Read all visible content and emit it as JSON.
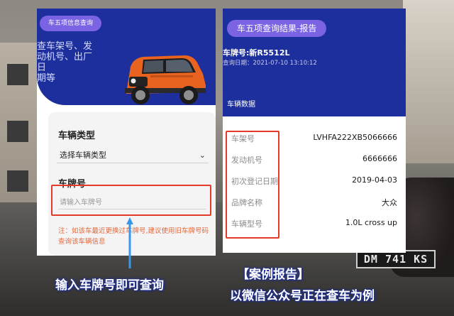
{
  "left_panel": {
    "pill": "车五项信息查询",
    "hero_lines": [
      "查车架号、发",
      "动机号、出厂日",
      "期等"
    ],
    "form": {
      "type_label": "车辆类型",
      "type_value": "选择车辆类型",
      "plate_label": "车牌号",
      "plate_placeholder": "请输入车牌号",
      "notice": "注：如该车最近更换过车牌号,建议使用旧车牌号码查询该车辆信息"
    }
  },
  "right_panel": {
    "pill": "车五项查询结果-报告",
    "plate": "车牌号:新R5512L",
    "date": "查询日期：2021-07-10 13:10:12",
    "section_title": "车辆数据",
    "rows": [
      {
        "key": "车架号",
        "value": "LVHFA222XB5066666"
      },
      {
        "key": "发动机号",
        "value": "6666666"
      },
      {
        "key": "初次登记日期",
        "value": "2019-04-03"
      },
      {
        "key": "品牌名称",
        "value": "大众"
      },
      {
        "key": "车辆型号",
        "value": "1.0L cross up"
      }
    ]
  },
  "captions": {
    "left": "输入车牌号即可查询",
    "right_line1": "【案例报告】",
    "right_line2": "以微信公众号正在查车为例"
  },
  "background": {
    "plate_text": "DM 741 KS"
  },
  "colors": {
    "brand_blue": "#1d2f9c",
    "pill_purple": "#7b63e3",
    "highlight_red": "#e33a2c",
    "notice_orange": "#e5683a"
  }
}
